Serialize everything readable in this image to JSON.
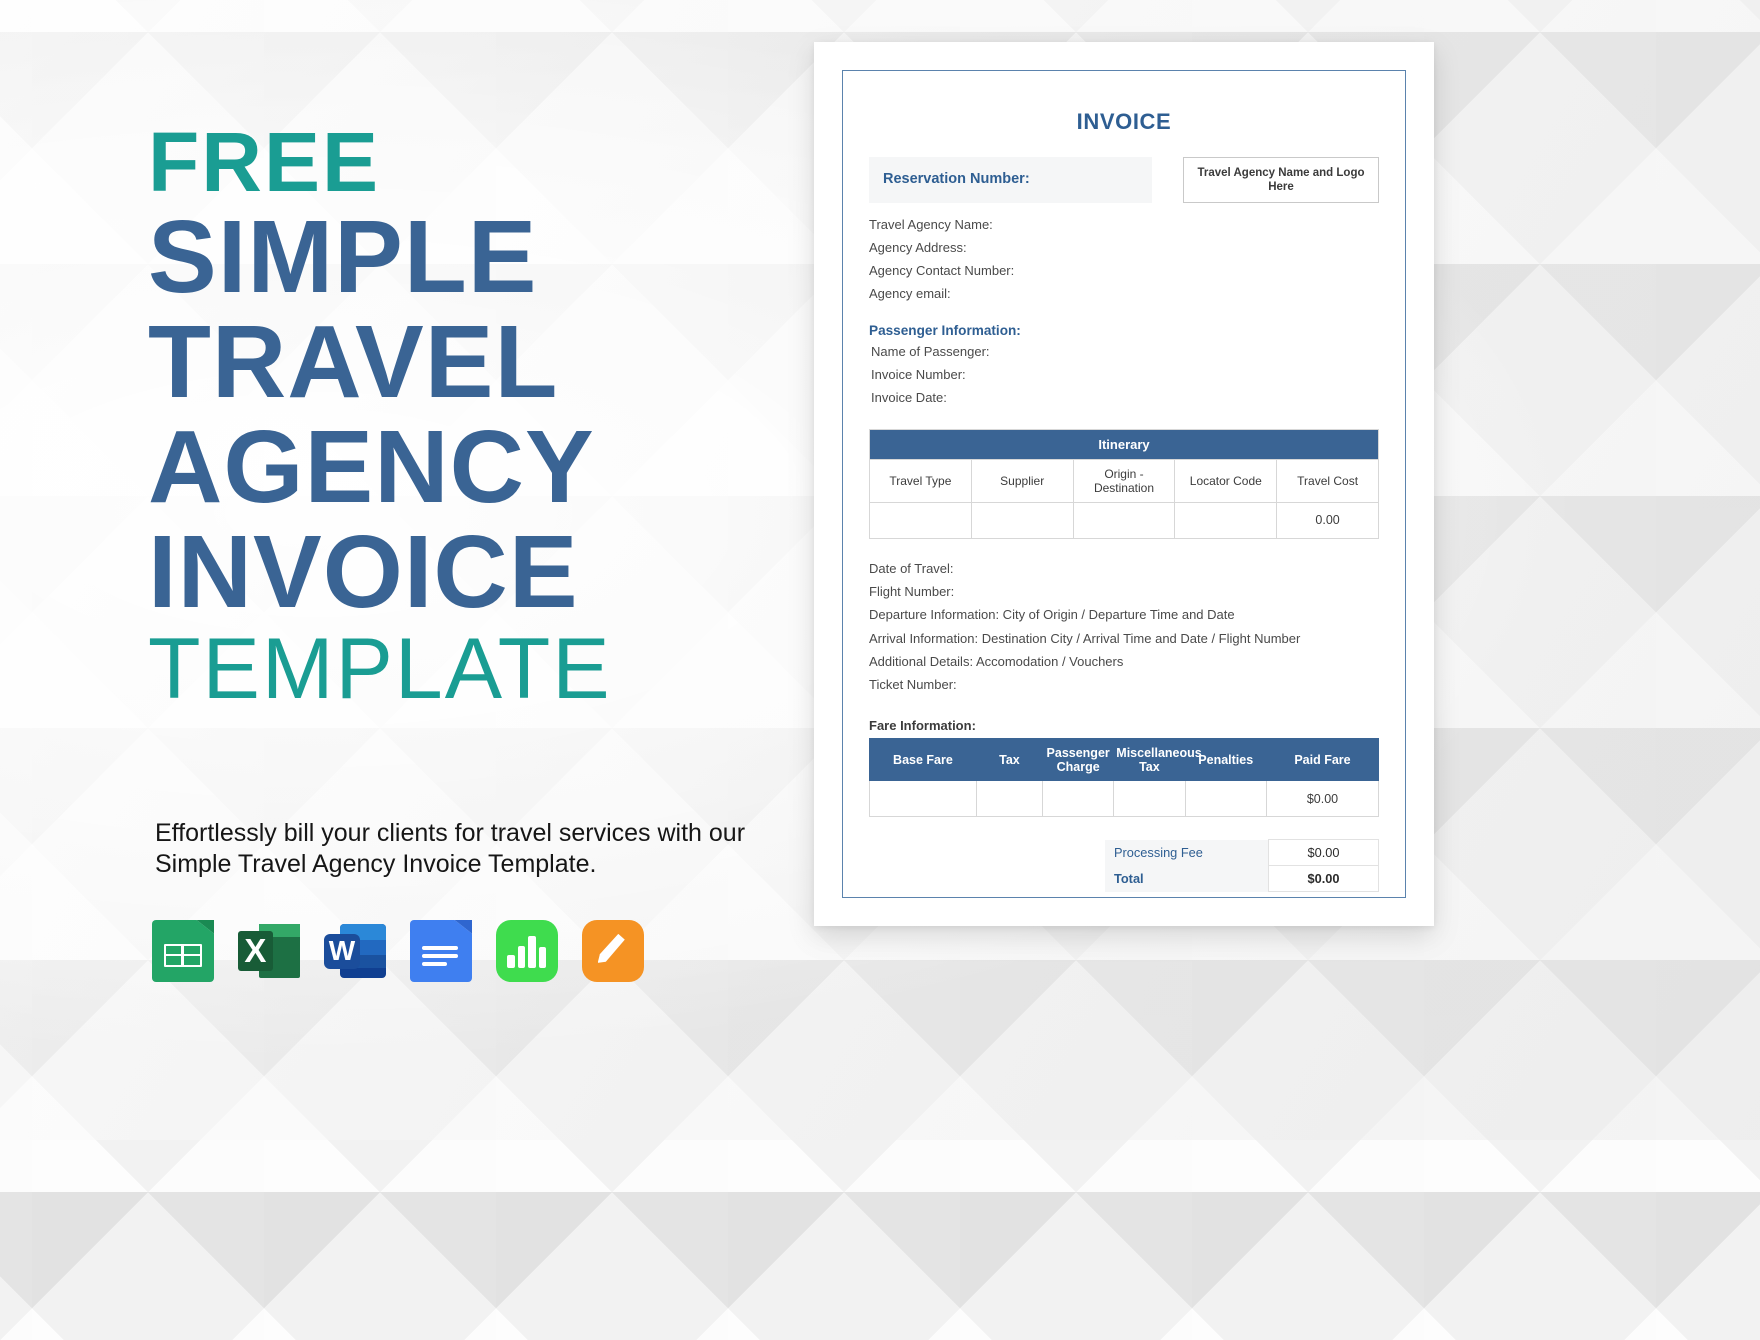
{
  "promo": {
    "lines": [
      {
        "text": "FREE",
        "accent": "teal"
      },
      {
        "text": "SIMPLE",
        "accent": "blue"
      },
      {
        "text": "TRAVEL",
        "accent": "blue"
      },
      {
        "text": "AGENCY",
        "accent": "blue"
      },
      {
        "text": "INVOICE",
        "accent": "blue"
      },
      {
        "text": "TEMPLATE",
        "accent": "teal"
      }
    ],
    "line_free": "FREE",
    "line_simple": "SIMPLE",
    "line_travel": "TRAVEL",
    "line_agency": "AGENCY",
    "line_invoice": "INVOICE",
    "line_template": "TEMPLATE",
    "tagline": "Effortlessly bill your clients for travel services with our Simple Travel Agency Invoice Template.",
    "colors": {
      "teal": "#1a9d93",
      "blue": "#3a6494",
      "tagline": "#161616"
    }
  },
  "format_icons": [
    {
      "name": "google-sheets-icon",
      "label": "Google Sheets",
      "color": "#23a566"
    },
    {
      "name": "microsoft-excel-icon",
      "label": "Microsoft Excel",
      "color": "#185c37"
    },
    {
      "name": "microsoft-word-icon",
      "label": "Microsoft Word",
      "color": "#103f91"
    },
    {
      "name": "google-docs-icon",
      "label": "Google Docs",
      "color": "#3f7ff0"
    },
    {
      "name": "apple-numbers-icon",
      "label": "Apple Numbers",
      "color": "#3fdc4e"
    },
    {
      "name": "apple-pages-icon",
      "label": "Apple Pages",
      "color": "#f59324"
    }
  ],
  "document": {
    "title": "INVOICE",
    "reservation_label": "Reservation Number:",
    "logo_placeholder": "Travel Agency Name and Logo Here",
    "agency_fields": [
      "Travel Agency Name:",
      "Agency Address:",
      "Agency Contact Number:",
      "Agency email:"
    ],
    "passenger_section_title": "Passenger Information:",
    "passenger_fields": [
      "Name of Passenger:",
      "Invoice Number:",
      "Invoice Date:"
    ],
    "itinerary": {
      "band_title": "Itinerary",
      "headers": [
        "Travel Type",
        "Supplier",
        "Origin - Destination",
        "Locator Code",
        "Travel Cost"
      ],
      "rows": [
        [
          "",
          "",
          "",
          "",
          "0.00"
        ]
      ]
    },
    "travel_details": [
      "Date of Travel:",
      "Flight Number:",
      "Departure Information: City of Origin / Departure Time and Date",
      "Arrival Information: Destination City / Arrival Time and Date / Flight Number",
      "Additional Details: Accomodation / Vouchers",
      "Ticket Number:"
    ],
    "fare": {
      "section_title": "Fare Information:",
      "headers": [
        "Base Fare",
        "Tax",
        "Passenger Charge",
        "Miscellaneous Tax",
        "Penalties",
        "Paid Fare"
      ],
      "rows": [
        [
          "",
          "",
          "",
          "",
          "",
          "$0.00"
        ]
      ]
    },
    "totals": [
      {
        "label": "Processing Fee",
        "value": "$0.00"
      },
      {
        "label": "Total",
        "value": "$0.00"
      }
    ],
    "colors": {
      "header_blue": "#3a6494",
      "title_blue": "#2e5e92",
      "border": "#5b83ad",
      "shade": "#f5f6f7"
    }
  }
}
